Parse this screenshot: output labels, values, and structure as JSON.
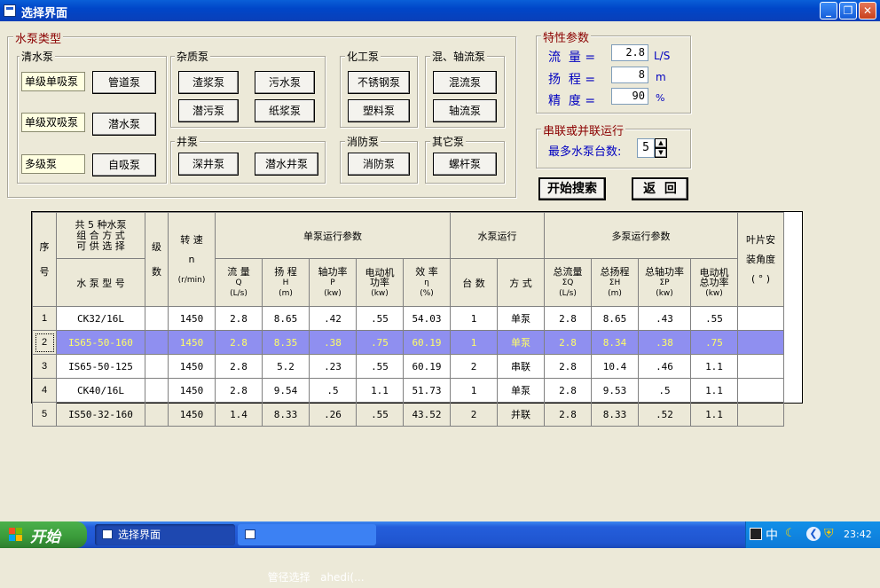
{
  "window": {
    "title": "选择界面"
  },
  "pump_types": {
    "title": "水泵类型",
    "clear_water": {
      "label": "清水泵",
      "items": [
        "单级单吸泵",
        "单级双吸泵",
        "多级泵"
      ],
      "buttons": [
        "管道泵",
        "潜水泵",
        "自吸泵"
      ]
    },
    "impurity": {
      "label": "杂质泵",
      "buttons": [
        "渣浆泵",
        "污水泵",
        "潜污泵",
        "纸浆泵"
      ]
    },
    "chemical": {
      "label": "化工泵",
      "buttons": [
        "不锈钢泵",
        "塑料泵"
      ]
    },
    "mixed_axial": {
      "label": "混、轴流泵",
      "buttons": [
        "混流泵",
        "轴流泵"
      ]
    },
    "well": {
      "label": "井泵",
      "buttons": [
        "深井泵",
        "潜水井泵"
      ]
    },
    "fire": {
      "label": "消防泵",
      "buttons": [
        "消防泵"
      ]
    },
    "other": {
      "label": "其它泵",
      "buttons": [
        "螺杆泵"
      ]
    }
  },
  "characteristics": {
    "title": "特性参数",
    "flow": {
      "label": "流  量 =",
      "value": "2.8",
      "unit": "L/S"
    },
    "head": {
      "label": "扬  程 =",
      "value": "8",
      "unit": "m"
    },
    "precision": {
      "label": "精  度 =",
      "value": "90",
      "unit": "%"
    }
  },
  "series_parallel": {
    "title": "串联或并联运行",
    "label": "最多水泵台数:",
    "value": "5"
  },
  "actions": {
    "search": "开始搜索",
    "back": "返  回"
  },
  "table": {
    "h_seq": [
      "序",
      "号"
    ],
    "h_combo": [
      "共 5 种水泵",
      "组 合 方 式",
      "可 供 选 择"
    ],
    "h_model": "水 泵 型 号",
    "h_stage": [
      "级",
      "数"
    ],
    "h_speed": [
      "转  速",
      "n",
      "(r/min)"
    ],
    "h_single": "单泵运行参数",
    "h_single_cols": [
      [
        "流  量",
        "Q",
        "(L/s)"
      ],
      [
        "扬  程",
        "H",
        "(m)"
      ],
      [
        "轴功率",
        "P",
        "(kw)"
      ],
      [
        "电动机",
        "功率",
        "(kw)"
      ],
      [
        "效  率",
        "η",
        "(%)"
      ]
    ],
    "h_run": "水泵运行",
    "h_run_cols": [
      "台  数",
      "方  式"
    ],
    "h_multi": "多泵运行参数",
    "h_multi_cols": [
      [
        "总流量",
        "ΣQ",
        "(L/s)"
      ],
      [
        "总扬程",
        "ΣH",
        "(m)"
      ],
      [
        "总轴功率",
        "ΣP",
        "(kw)"
      ],
      [
        "电动机",
        "总功率",
        "(kw)"
      ]
    ],
    "h_blade": [
      "叶片安",
      "装角度",
      "( ° )"
    ],
    "rows": [
      [
        "1",
        "CK32/16L",
        "",
        "1450",
        "2.8",
        "8.65",
        ".42",
        ".55",
        "54.03",
        "1",
        "单泵",
        "2.8",
        "8.65",
        ".43",
        ".55",
        ""
      ],
      [
        "2",
        "IS65-50-160",
        "",
        "1450",
        "2.8",
        "8.35",
        ".38",
        ".75",
        "60.19",
        "1",
        "单泵",
        "2.8",
        "8.34",
        ".38",
        ".75",
        ""
      ],
      [
        "3",
        "IS65-50-125",
        "",
        "1450",
        "2.8",
        "5.2",
        ".23",
        ".55",
        "60.19",
        "2",
        "串联",
        "2.8",
        "10.4",
        ".46",
        "1.1",
        ""
      ],
      [
        "4",
        "CK40/16L",
        "",
        "1450",
        "2.8",
        "9.54",
        ".5",
        "1.1",
        "51.73",
        "1",
        "单泵",
        "2.8",
        "9.53",
        ".5",
        "1.1",
        ""
      ],
      [
        "5",
        "IS50-32-160",
        "",
        "1450",
        "1.4",
        "8.33",
        ".26",
        ".55",
        "43.52",
        "2",
        "并联",
        "2.8",
        "8.33",
        ".52",
        "1.1",
        ""
      ]
    ],
    "selected_row": 1
  },
  "taskbar": {
    "start": "开始",
    "tasks": [
      "选择界面",
      "管径选择   ahedi(..."
    ],
    "ime": "中",
    "clock": "23:42"
  }
}
